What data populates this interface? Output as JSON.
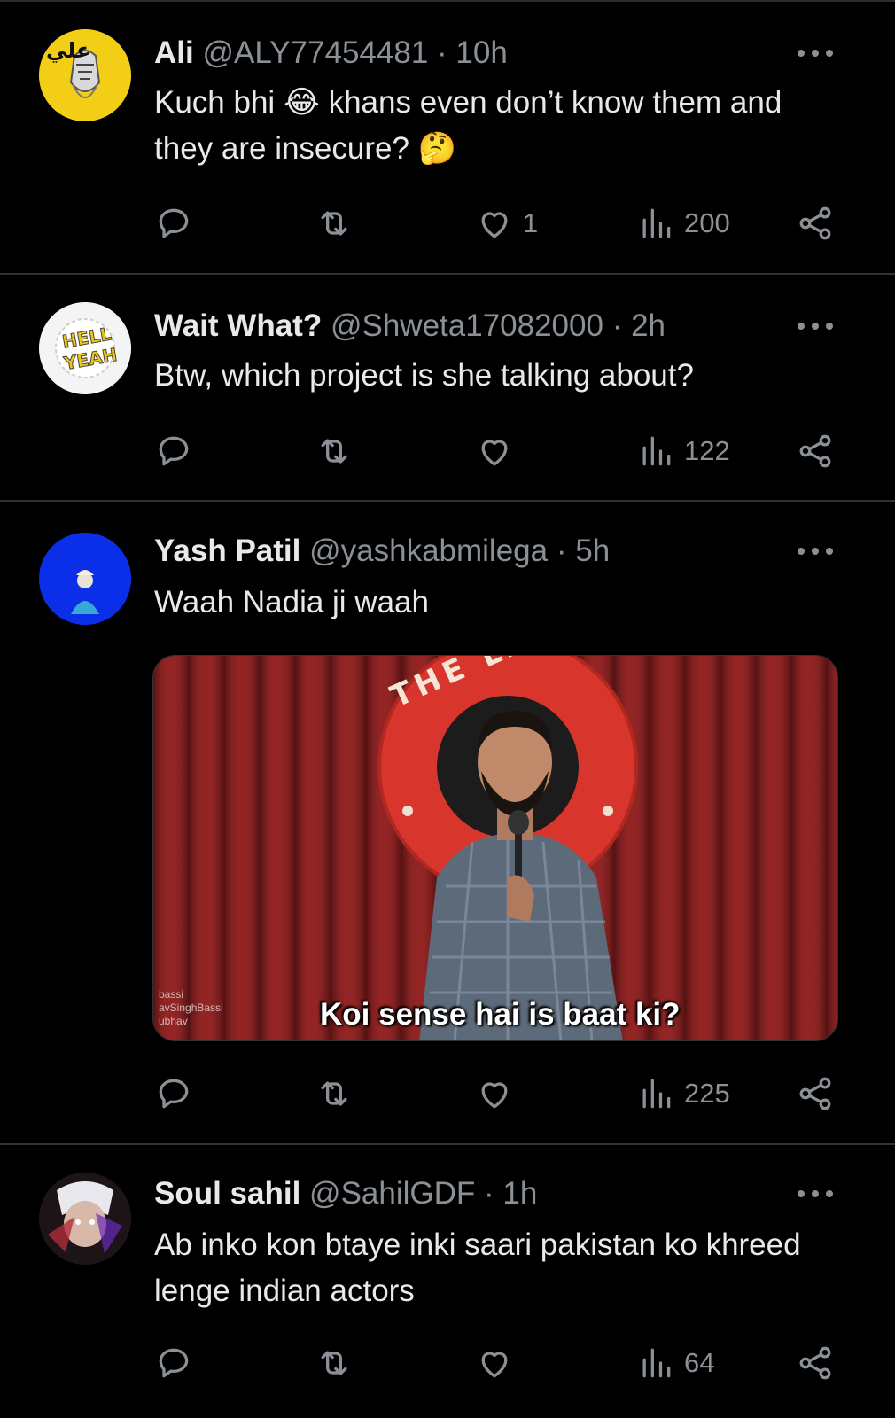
{
  "tweets": [
    {
      "name": "Ali",
      "handle": "@ALY77454481",
      "time": "10h",
      "text_parts": [
        "Kuch bhi ",
        " khans even don’t know them and they are insecure? "
      ],
      "emoji_1": "😂",
      "emoji_2": "🤔",
      "avatar_text": "علي",
      "stats": {
        "reply": "",
        "retweet": "",
        "like": "1",
        "views": "200"
      }
    },
    {
      "name": "Wait What?",
      "handle": "@Shweta17082000",
      "time": "2h",
      "text": "Btw, which project is she talking about?",
      "avatar_text_1": "HELL",
      "avatar_text_2": "YEAH",
      "stats": {
        "reply": "",
        "retweet": "",
        "like": "",
        "views": "122"
      }
    },
    {
      "name": "Yash Patil",
      "handle": "@yashkabmilega",
      "time": "5h",
      "text": "Waah Nadia ji waah",
      "media": {
        "caption": "Koi sense hai is baat ki?",
        "sign_text": "THE LAUGH",
        "watermark_1": "bassi",
        "watermark_2": "avSinghBassi",
        "watermark_3": "ubhav"
      },
      "stats": {
        "reply": "",
        "retweet": "",
        "like": "",
        "views": "225"
      }
    },
    {
      "name": "Soul sahil",
      "handle": "@SahilGDF",
      "time": "1h",
      "text": "Ab inko kon btaye inki saari pakistan ko khreed lenge indian actors",
      "stats": {
        "reply": "",
        "retweet": "",
        "like": "",
        "views": "64"
      }
    }
  ],
  "separator": "·",
  "colors": {
    "background": "#000000",
    "text": "#e7e9ea",
    "muted": "#8b9096",
    "divider": "#2f3336"
  }
}
